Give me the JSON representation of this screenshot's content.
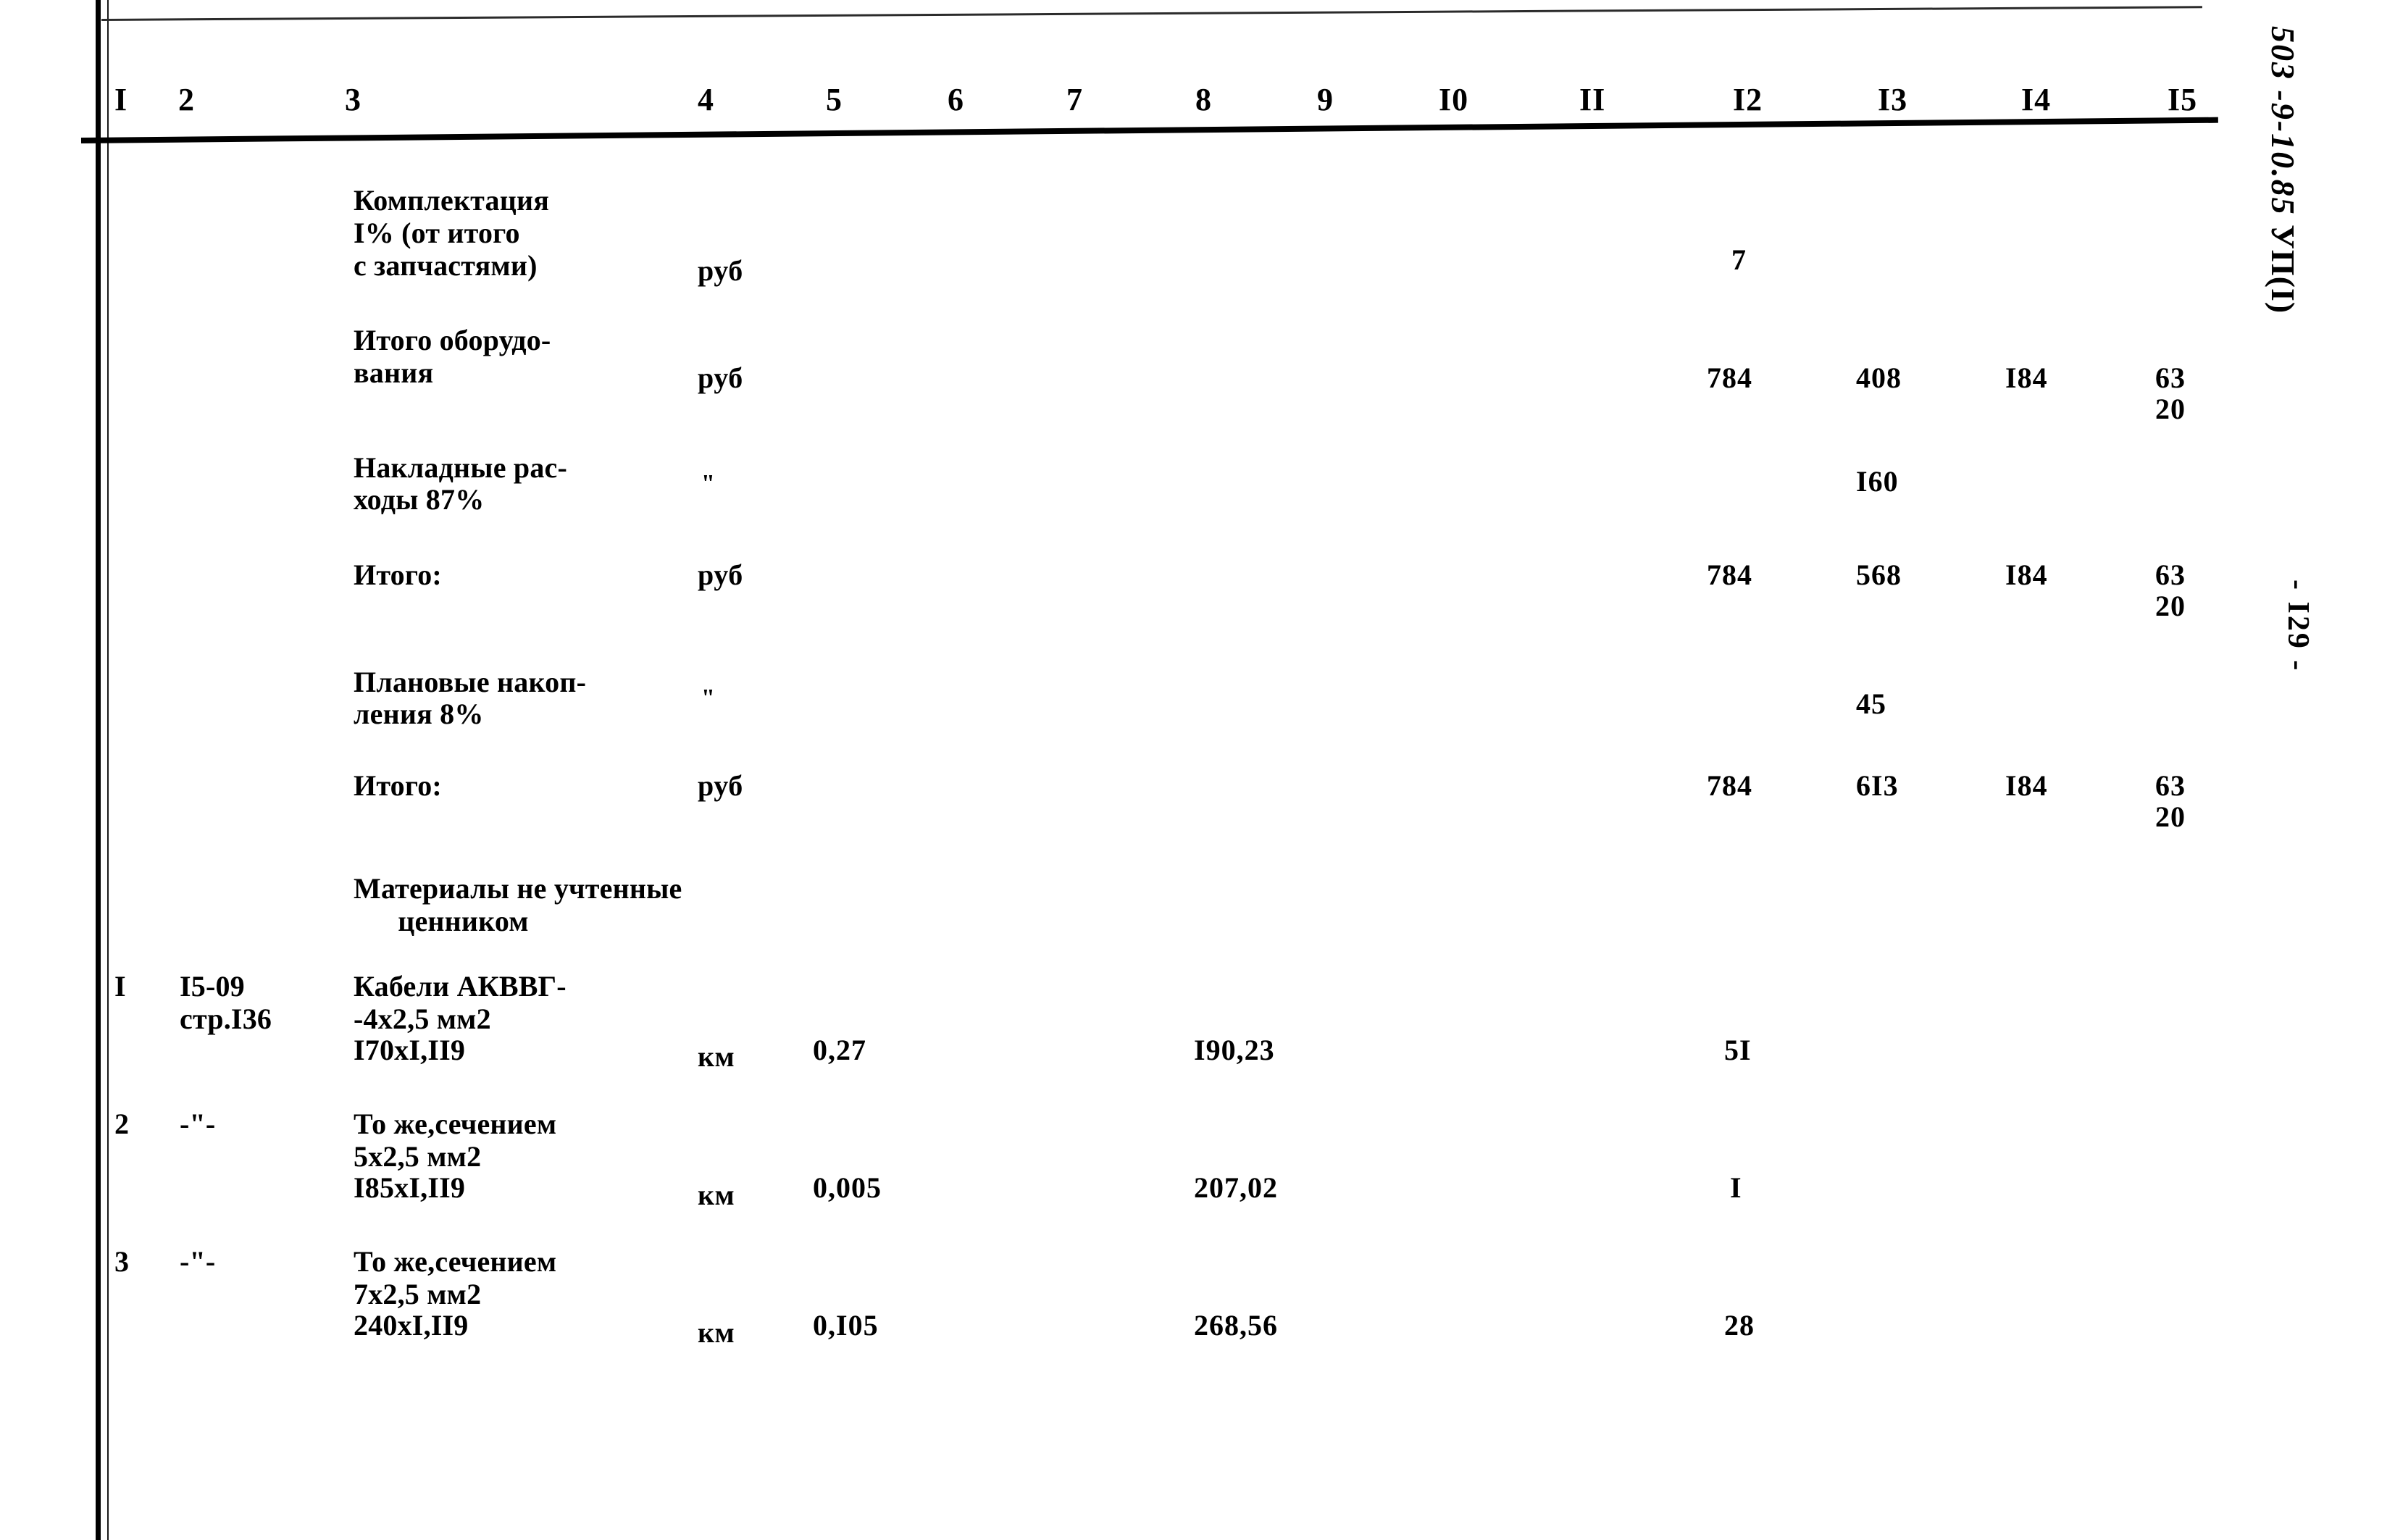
{
  "document": {
    "sheet_code": "503 -9-10.85",
    "sheet_suffix": "УП(I)",
    "page_number": "- I29 -"
  },
  "table": {
    "column_headers": [
      "I",
      "2",
      "3",
      "4",
      "5",
      "6",
      "7",
      "8",
      "9",
      "I0",
      "II",
      "I2",
      "I3",
      "I4",
      "I5"
    ],
    "rows": [
      {
        "no": "",
        "code": "",
        "description": [
          "Комплектация",
          "I% (от итого",
          "с запчастями)"
        ],
        "unit": "руб",
        "c5": "",
        "c8": "",
        "c12": "7",
        "c13": "",
        "c14": "",
        "c15": []
      },
      {
        "no": "",
        "code": "",
        "description": [
          "Итого оборудо-",
          "вания"
        ],
        "unit": "руб",
        "c5": "",
        "c8": "",
        "c12": "784",
        "c13": "408",
        "c14": "I84",
        "c15": [
          "63",
          "20"
        ]
      },
      {
        "no": "",
        "code": "",
        "description": [
          "Накладные рас-",
          "ходы 87%"
        ],
        "unit": "\"",
        "c5": "",
        "c8": "",
        "c12": "",
        "c13": "I60",
        "c14": "",
        "c15": []
      },
      {
        "no": "",
        "code": "",
        "description": [
          "Итого:"
        ],
        "unit": "руб",
        "c5": "",
        "c8": "",
        "c12": "784",
        "c13": "568",
        "c14": "I84",
        "c15": [
          "63",
          "20"
        ]
      },
      {
        "no": "",
        "code": "",
        "description": [
          "Плановые накоп-",
          "ления 8%"
        ],
        "unit": "\"",
        "c5": "",
        "c8": "",
        "c12": "",
        "c13": "45",
        "c14": "",
        "c15": []
      },
      {
        "no": "",
        "code": "",
        "description": [
          "Итого:"
        ],
        "unit": "руб",
        "c5": "",
        "c8": "",
        "c12": "784",
        "c13": "6I3",
        "c14": "I84",
        "c15": [
          "63",
          "20"
        ]
      },
      {
        "no": "",
        "code": "",
        "description": [
          "Материалы не учтенные",
          "      ценником"
        ],
        "unit": "",
        "c5": "",
        "c8": "",
        "c12": "",
        "c13": "",
        "c14": "",
        "c15": []
      },
      {
        "no": "I",
        "code": [
          "I5-09",
          "стр.I36"
        ],
        "description": [
          "Кабели АКВВГ-",
          "-4х2,5 мм2",
          "I70хI,II9"
        ],
        "unit": "км",
        "c5": "0,27",
        "c8": "I90,23",
        "c12": "5I",
        "c13": "",
        "c14": "",
        "c15": []
      },
      {
        "no": "2",
        "code": [
          "-\"-"
        ],
        "description": [
          "То же,сечением",
          "5х2,5 мм2",
          "I85хI,II9"
        ],
        "unit": "км",
        "c5": "0,005",
        "c8": "207,02",
        "c12": "I",
        "c13": "",
        "c14": "",
        "c15": []
      },
      {
        "no": "3",
        "code": [
          "-\"-"
        ],
        "description": [
          "То же,сечением",
          "7х2,5 мм2",
          "240хI,II9"
        ],
        "unit": "км",
        "c5": "0,I05",
        "c8": "268,56",
        "c12": "28",
        "c13": "",
        "c14": "",
        "c15": []
      }
    ]
  }
}
